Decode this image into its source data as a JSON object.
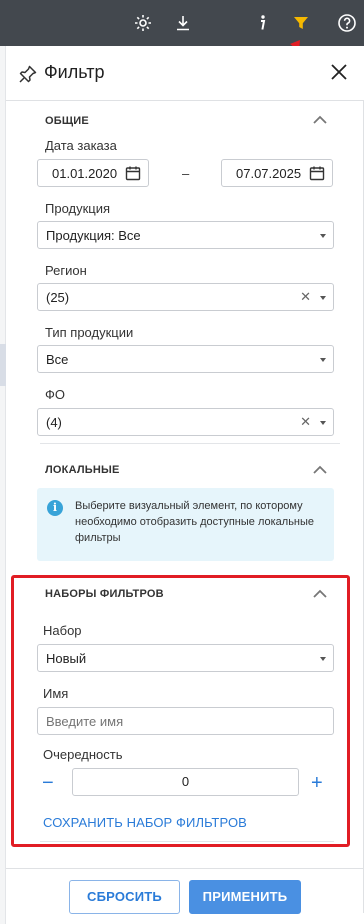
{
  "panel": {
    "title": "Фильтр"
  },
  "toolbar": {
    "icons": [
      "gear-icon",
      "download-icon",
      "info-icon",
      "filter-icon",
      "help-icon"
    ],
    "accent_color": "#f5b800"
  },
  "general": {
    "title": "ОБЩИЕ",
    "order_date_label": "Дата заказа",
    "date_from": "01.01.2020",
    "date_separator": "–",
    "date_to": "07.07.2025",
    "product_label": "Продукция",
    "product_value": "Продукция: Все",
    "region_label": "Регион",
    "region_value": "(25)",
    "product_type_label": "Тип продукции",
    "product_type_value": "Все",
    "fo_label": "ФО",
    "fo_value": "(4)",
    "clear_glyph": "✕"
  },
  "local": {
    "title": "ЛОКАЛЬНЫЕ",
    "info_text": "Выберите визуальный элемент, по которому необходимо отобразить доступные локальные фильтры",
    "info_glyph": "i"
  },
  "sets": {
    "title": "НАБОРЫ ФИЛЬТРОВ",
    "set_label": "Набор",
    "set_value": "Новый",
    "name_label": "Имя",
    "name_placeholder": "Введите имя",
    "order_label": "Очередность",
    "order_value": "0",
    "minus_glyph": "−",
    "plus_glyph": "+",
    "save_link": "СОХРАНИТЬ НАБОР ФИЛЬТРОВ"
  },
  "footer": {
    "reset_label": "СБРОСИТЬ",
    "apply_label": "ПРИМЕНИТЬ"
  },
  "colors": {
    "highlight": "#e11d24",
    "primary": "#4a90e2",
    "link": "#2a7bd8"
  }
}
